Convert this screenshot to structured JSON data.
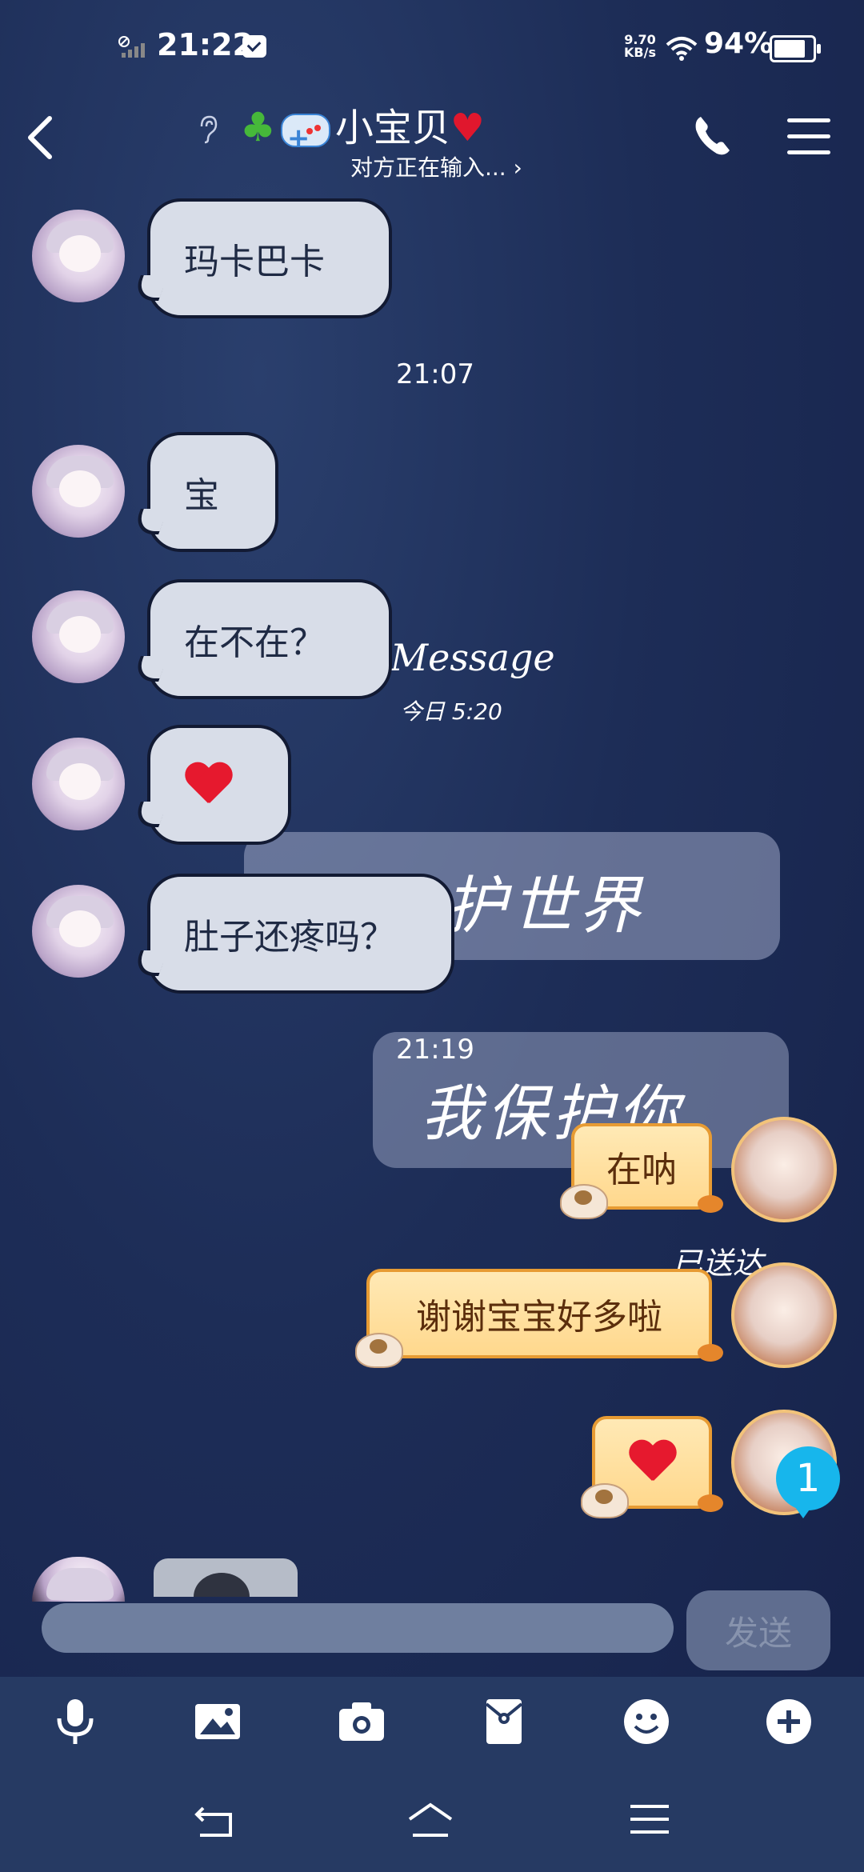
{
  "status_bar": {
    "time": "21:22",
    "net_speed_value": "9.70",
    "net_speed_unit": "KB/s",
    "battery_percent": "94%",
    "battery_level": 0.94
  },
  "header": {
    "contact_name": "小宝贝",
    "typing_status": "对方正在输入...",
    "icons": [
      "back-icon",
      "ear-icon",
      "clover-icon",
      "gamepad-icon",
      "heart-icon",
      "phone-icon",
      "menu-icon"
    ]
  },
  "background_decor": {
    "message_word": "Message",
    "date_text": "今日 5:20",
    "bubble1_text": "护世界",
    "bubble2_text": "我保护你",
    "sent_text": "已送达"
  },
  "timestamps": [
    "21:07",
    "21:19"
  ],
  "messages": [
    {
      "side": "left",
      "text": "玛卡巴卡"
    },
    {
      "side": "left",
      "text": "宝"
    },
    {
      "side": "left",
      "text": "在不在？"
    },
    {
      "side": "left",
      "text": "",
      "emoji": "heart"
    },
    {
      "side": "left",
      "text": "肚子还疼吗？"
    },
    {
      "side": "right",
      "text": "在呐"
    },
    {
      "side": "right",
      "text": "谢谢宝宝好多啦"
    },
    {
      "side": "right",
      "text": "",
      "emoji": "heart"
    }
  ],
  "unread_badge": "1",
  "composer": {
    "input_value": "",
    "send_label": "发送"
  },
  "toolbar": [
    "microphone-icon",
    "image-icon",
    "camera-icon",
    "red-packet-icon",
    "emoji-icon",
    "plus-icon"
  ],
  "navbar": [
    "back-nav-icon",
    "home-nav-icon",
    "recents-nav-icon"
  ],
  "colors": {
    "background": "#1d2d57",
    "left_bubble": "#d8dde8",
    "right_bubble": "#ffd88d",
    "badge": "#17b6ec",
    "heart": "#e6192e"
  }
}
